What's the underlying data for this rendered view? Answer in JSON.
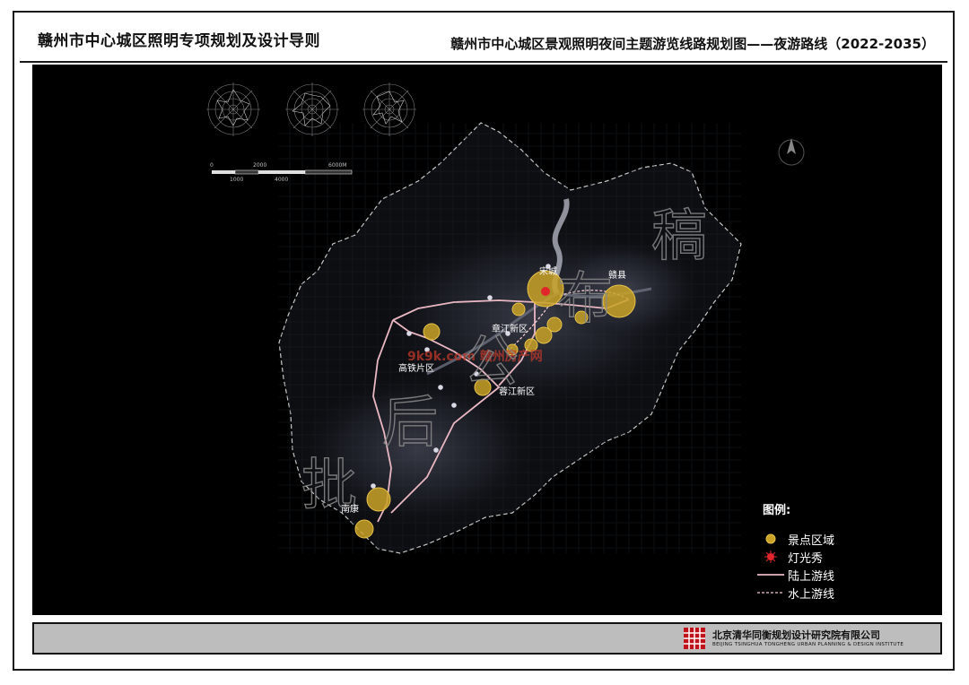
{
  "header": {
    "title_left": "赣州市中心城区照明专项规划及设计导则",
    "title_right": "赣州市中心城区景观照明夜间主题游览线路规划图——夜游路线（2022-2035）"
  },
  "map": {
    "places": {
      "songcheng": "宋城",
      "ganxian": "赣县",
      "zhangjiang": "章江新区",
      "gaotie": "高铁片区",
      "rongjiang": "蓉江新区",
      "nankang": "南康"
    },
    "scale_bar": {
      "upper_ticks": [
        "0",
        "2000",
        "6000M"
      ],
      "lower_ticks": [
        "1000",
        "4000"
      ]
    },
    "watermark_text": [
      "批",
      "后",
      "公",
      "布",
      "稿"
    ],
    "site_watermark": "9k9k.com 赣州房产网",
    "colors": {
      "background": "#000000",
      "scenic": "#c9a227",
      "land_route": "#e9b7c2",
      "water_route": "#f2c8d0",
      "light_show": "#e0262a"
    }
  },
  "legend": {
    "title": "图例:",
    "items": [
      {
        "label": "景点区域",
        "symbol": "scenic-area"
      },
      {
        "label": "灯光秀",
        "symbol": "light-show"
      },
      {
        "label": "陆上游线",
        "symbol": "land-route"
      },
      {
        "label": "水上游线",
        "symbol": "water-route"
      }
    ]
  },
  "footer": {
    "institute_cn": "北京清华同衡规划设计研究院有限公司",
    "institute_en": "BEIJING TSINGHUA TONGHENG URBAN PLANNING & DESIGN INSTITUTE"
  }
}
